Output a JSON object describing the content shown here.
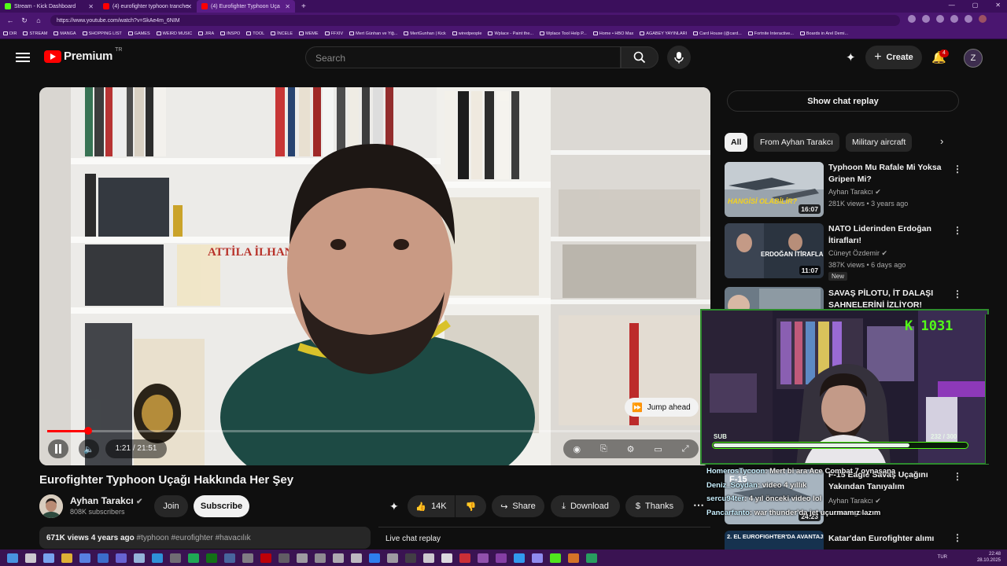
{
  "browser": {
    "tabs": [
      {
        "label": "Stream - Kick Dashboard",
        "color": "#53fc18"
      },
      {
        "label": "(4) eurofighter typhoon tranche",
        "color": "#ff0000"
      },
      {
        "label": "(4) Eurofighter Typhoon Uça",
        "color": "#ff0000"
      }
    ],
    "url": "https://www.youtube.com/watch?v=SkAe4m_6NIM",
    "bookmarks": [
      "DIR",
      "STREAM",
      "MANGA",
      "SHOPPING LIST",
      "GAMES",
      "WEIRD MUSIC",
      "JIRA",
      "INSPO",
      "TOOL",
      "İNCELE",
      "MEME",
      "FFXIV",
      "Mert Günhan ve Yiğ...",
      "MertGunhan | Kick",
      "wiredpeople",
      "Wplace - Paint the...",
      "Wplace Tool Help P...",
      "Home • HBO Max",
      "AGABEY YAYINLARI",
      "Card House (@card...",
      "Fortnite Interactive...",
      "Boards in Arel Demi..."
    ]
  },
  "header": {
    "logo_text": "Premium",
    "logo_region": "TR",
    "search_placeholder": "Search",
    "create_label": "Create",
    "notification_count": "4",
    "accent": "#ff0000"
  },
  "player": {
    "time": "1:21 / 21:51",
    "progress": 0.062,
    "jump_ahead_label": "Jump ahead",
    "book_title": "ATTİLA İLHAN"
  },
  "video": {
    "title": "Eurofighter Typhoon Uçağı Hakkında Her Şey",
    "channel_name": "Ayhan Tarakcı",
    "subscribers": "808K subscribers",
    "join_label": "Join",
    "subscribe_label": "Subscribe",
    "likes": "14K",
    "share_label": "Share",
    "download_label": "Download",
    "thanks_label": "Thanks",
    "views_age": "671K views  4 years ago",
    "tags": "#typhoon #eurofighter #havacılık",
    "live_chat_replay": "Live chat replay"
  },
  "sidebar": {
    "show_chat_replay": "Show chat replay",
    "chips": [
      "All",
      "From Ayhan Tarakcı",
      "Military aircraft"
    ],
    "recommendations": [
      {
        "title": "Typhoon Mu Rafale Mi Yoksa Gripen Mi?",
        "channel": "Ayhan Tarakcı",
        "meta": "281K views • 3 years ago",
        "duration": "16:07",
        "thumb_text": "HANGİSİ OLABİLİR?"
      },
      {
        "title": "NATO Liderinden Erdoğan İtirafları!",
        "channel": "Cüneyt Özdemir",
        "meta": "387K views • 6 days ago",
        "duration": "11:07",
        "badge": "New",
        "thumb_text": "ERDOĞAN İTİRAFLARI"
      },
      {
        "title": "SAVAŞ PİLOTU, İT DALAŞI SAHNELERİNİ İZLİYOR!",
        "channel": "",
        "meta": ""
      },
      {
        "title": "F-15 Eagle Savaş Uçağını Yakından Tanıyalım",
        "channel": "Ayhan Tarakcı",
        "meta": "...ears ago",
        "duration": "24:23"
      },
      {
        "title": "Katar'dan Eurofighter alımı",
        "thumb_text": "2. EL EUROFIGHTER'DA AVANTAJLAR VE"
      }
    ]
  },
  "stream_overlay": {
    "kick_count": "K 1031",
    "sub_label": "SUB",
    "sub_count": "232 / 300",
    "sub_progress": 0.773,
    "accent": "#53fc18",
    "chat": [
      {
        "user": "HomerosTycoon",
        "msg": ": Mert bi ara Ace Combat 7 oynasana"
      },
      {
        "user": "Deniz_Soydan",
        "msg": ": video 4 yıllık"
      },
      {
        "user": "sercu94ter",
        "msg": ": 4 yıl önceki video lol"
      },
      {
        "user": "Pancarfanto",
        "msg": ": war thunder'da jet uçurmamız lazım"
      }
    ]
  },
  "taskbar": {
    "lang": "TUR",
    "time": "22:48",
    "date": "28.10.2025"
  }
}
